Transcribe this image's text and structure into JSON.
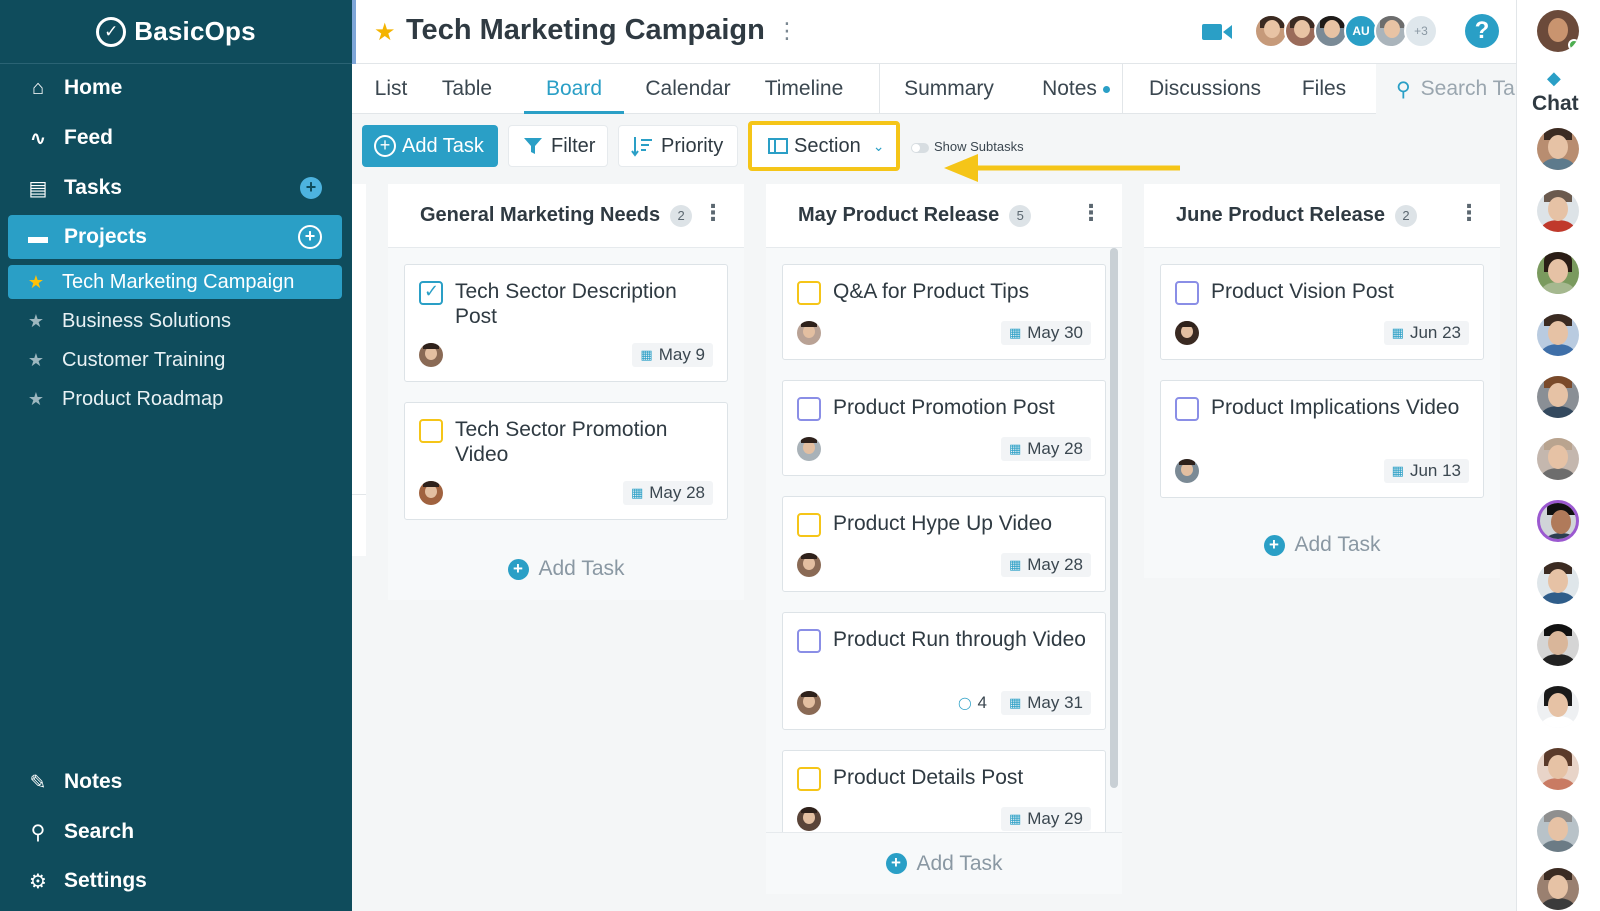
{
  "app": {
    "name": "BasicOps"
  },
  "sidebar": {
    "nav": [
      {
        "label": "Home",
        "icon": "home-icon",
        "glyph": "⌂"
      },
      {
        "label": "Feed",
        "icon": "activity-icon",
        "glyph": "∿"
      },
      {
        "label": "Tasks",
        "icon": "clipboard-icon",
        "glyph": "▤"
      },
      {
        "label": "Projects",
        "icon": "folder-icon",
        "glyph": "▬"
      }
    ],
    "projects": [
      {
        "label": "Tech Marketing Campaign",
        "starred": true
      },
      {
        "label": "Business Solutions",
        "starred": false
      },
      {
        "label": "Customer Training",
        "starred": false
      },
      {
        "label": "Product Roadmap",
        "starred": false
      }
    ],
    "bottom": [
      {
        "label": "Notes",
        "icon": "pencil-icon",
        "glyph": "✎"
      },
      {
        "label": "Search",
        "icon": "search-icon",
        "glyph": "⚲"
      },
      {
        "label": "Settings",
        "icon": "gear-icon",
        "glyph": "⚙"
      }
    ]
  },
  "header": {
    "title": "Tech Marketing Campaign",
    "avatar_badge": "AU",
    "avatar_more": "+3",
    "help": "?"
  },
  "tabs": [
    "List",
    "Table",
    "Board",
    "Calendar",
    "Timeline",
    "Summary",
    "Notes",
    "Discussions",
    "Files"
  ],
  "active_tab": "Board",
  "search": {
    "placeholder": "Search Ta"
  },
  "toolbar": {
    "add_task": "Add Task",
    "filter": "Filter",
    "priority": "Priority",
    "section": "Section",
    "show_subtasks": "Show Subtasks"
  },
  "columns": [
    {
      "title": "General Marketing Needs",
      "count": "2",
      "add_task": "Add Task",
      "cards": [
        {
          "title": "Tech Sector Description Post",
          "date": "May 9",
          "checkbox": "done"
        },
        {
          "title": "Tech Sector Promotion Video",
          "date": "May 28",
          "checkbox": "yellow"
        }
      ]
    },
    {
      "title": "May Product Release",
      "count": "5",
      "add_task": "Add Task",
      "cards": [
        {
          "title": "Q&A for Product Tips",
          "date": "May 30",
          "checkbox": "yellow"
        },
        {
          "title": "Product Promotion Post",
          "date": "May 28",
          "checkbox": "purple"
        },
        {
          "title": "Product Hype Up Video",
          "date": "May 28",
          "checkbox": "yellow"
        },
        {
          "title": "Product Run through Video",
          "date": "May 31",
          "checkbox": "purple",
          "comments": "4"
        },
        {
          "title": "Product Details Post",
          "date": "May 29",
          "checkbox": "yellow"
        }
      ]
    },
    {
      "title": "June Product Release",
      "count": "2",
      "add_task": "Add Task",
      "cards": [
        {
          "title": "Product Vision Post",
          "date": "Jun 23",
          "checkbox": "purple"
        },
        {
          "title": "Product Implications Video",
          "date": "Jun 13",
          "checkbox": "purple"
        }
      ]
    }
  ],
  "rail": {
    "chat_label": "Chat"
  },
  "colors": {
    "primary": "#2a9fc6",
    "sidebar": "#0f4c5c",
    "highlight": "#f5c518",
    "star": "#f4b400"
  }
}
